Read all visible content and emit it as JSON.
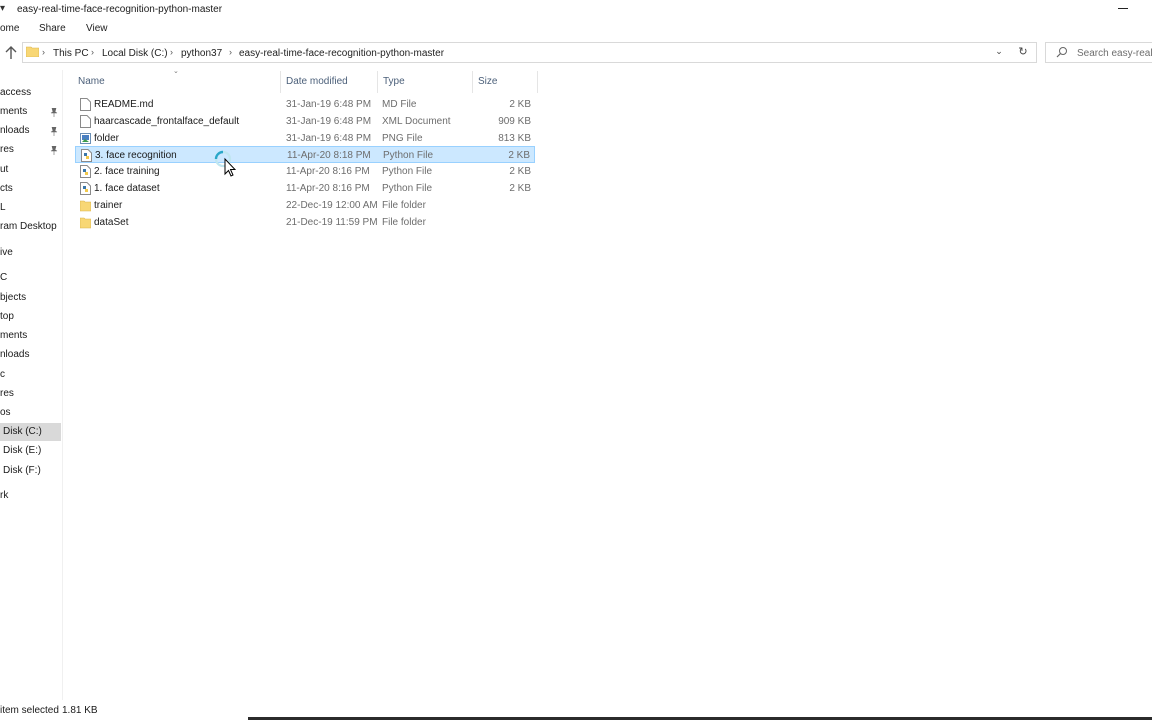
{
  "window": {
    "title": "easy-real-time-face-recognition-python-master"
  },
  "ribbon": {
    "tabs": [
      "ome",
      "Share",
      "View"
    ]
  },
  "address": {
    "crumbs": [
      "This PC",
      "Local Disk (C:)",
      "python37",
      "easy-real-time-face-recognition-python-master"
    ],
    "search_placeholder": "Search easy-real-t"
  },
  "navpane": {
    "items": [
      {
        "label": "access",
        "pinned": false
      },
      {
        "label": "ments",
        "pinned": true
      },
      {
        "label": "nloads",
        "pinned": true
      },
      {
        "label": "res",
        "pinned": true
      },
      {
        "label": "ut",
        "pinned": false
      },
      {
        "label": "cts",
        "pinned": false
      },
      {
        "label": "L",
        "pinned": false
      },
      {
        "label": "ram Desktop",
        "pinned": false
      },
      {
        "label": "ive",
        "pinned": false
      },
      {
        "label": "C",
        "pinned": false
      },
      {
        "label": "bjects",
        "pinned": false
      },
      {
        "label": "top",
        "pinned": false
      },
      {
        "label": "ments",
        "pinned": false
      },
      {
        "label": "nloads",
        "pinned": false
      },
      {
        "label": "c",
        "pinned": false
      },
      {
        "label": "res",
        "pinned": false
      },
      {
        "label": "os",
        "pinned": false
      },
      {
        "label": "Disk (C:)",
        "pinned": false,
        "selected": true
      },
      {
        "label": "Disk (E:)",
        "pinned": false
      },
      {
        "label": "Disk (F:)",
        "pinned": false
      },
      {
        "label": "rk",
        "pinned": false
      }
    ]
  },
  "columns": {
    "name": "Name",
    "date": "Date modified",
    "type": "Type",
    "size": "Size"
  },
  "files": [
    {
      "name": "README.md",
      "date": "31-Jan-19 6:48 PM",
      "type": "MD File",
      "size": "2 KB",
      "icon": "document-icon"
    },
    {
      "name": "haarcascade_frontalface_default",
      "date": "31-Jan-19 6:48 PM",
      "type": "XML Document",
      "size": "909 KB",
      "icon": "document-icon"
    },
    {
      "name": "folder",
      "date": "31-Jan-19 6:48 PM",
      "type": "PNG File",
      "size": "813 KB",
      "icon": "image-file-icon"
    },
    {
      "name": "3. face recognition",
      "date": "11-Apr-20 8:18 PM",
      "type": "Python File",
      "size": "2 KB",
      "icon": "python-file-icon",
      "selected": true
    },
    {
      "name": "2. face training",
      "date": "11-Apr-20 8:16 PM",
      "type": "Python File",
      "size": "2 KB",
      "icon": "python-file-icon"
    },
    {
      "name": "1. face dataset",
      "date": "11-Apr-20 8:16 PM",
      "type": "Python File",
      "size": "2 KB",
      "icon": "python-file-icon"
    },
    {
      "name": "trainer",
      "date": "22-Dec-19 12:00 AM",
      "type": "File folder",
      "size": "",
      "icon": "folder-icon"
    },
    {
      "name": "dataSet",
      "date": "21-Dec-19 11:59 PM",
      "type": "File folder",
      "size": "",
      "icon": "folder-icon"
    }
  ],
  "status": {
    "selection": "item selected",
    "size": "1.81 KB"
  },
  "colors": {
    "selection_bg": "#cce8ff",
    "selection_border": "#99d1ff",
    "folder": "#f8d775",
    "header_text": "#4c607a"
  }
}
